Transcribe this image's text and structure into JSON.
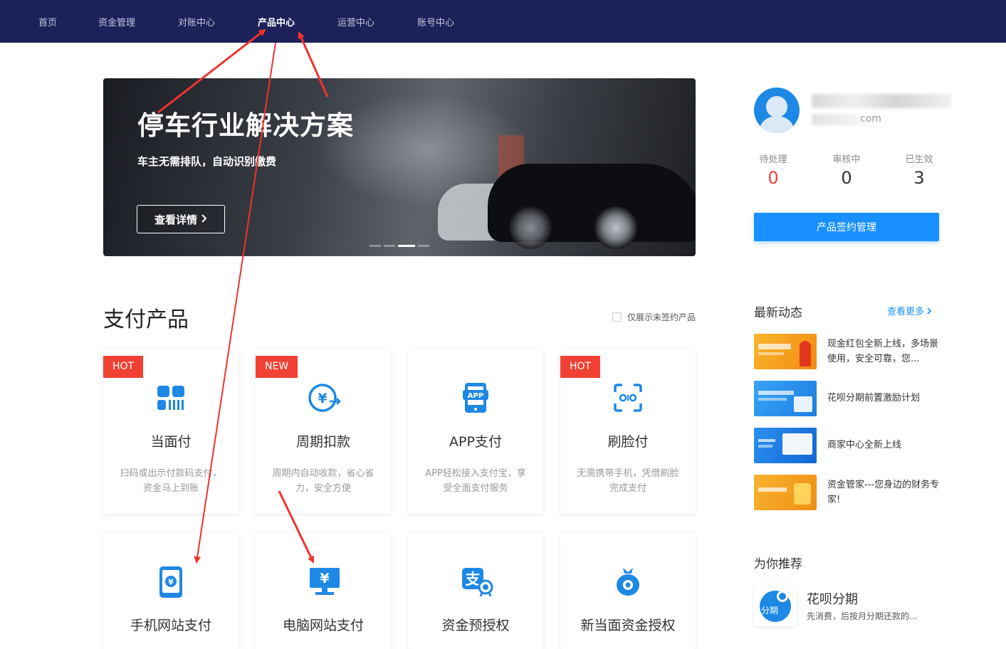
{
  "nav": {
    "items": [
      "首页",
      "资金管理",
      "对账中心",
      "产品中心",
      "运营中心",
      "账号中心"
    ],
    "active_index": 3
  },
  "banner": {
    "title": "停车行业解决方案",
    "subtitle": "车主无需排队，自动识别缴费",
    "button": "查看详情",
    "slide_count": 4,
    "active_slide": 2
  },
  "products": {
    "title": "支付产品",
    "filter_label": "仅展示未签约产品",
    "cards": [
      {
        "badge": "HOT",
        "name": "当面付",
        "desc": "扫码或出示付款码支付，资金马上到账",
        "icon": "qr-pay-icon"
      },
      {
        "badge": "NEW",
        "name": "周期扣款",
        "desc": "周期内自动收款，省心省力，安全方便",
        "icon": "cycle-deduct-icon"
      },
      {
        "badge": "",
        "name": "APP支付",
        "desc": "APP轻松接入支付宝，享受全面支付服务",
        "icon": "app-pay-icon"
      },
      {
        "badge": "HOT",
        "name": "刷脸付",
        "desc": "无需携带手机，凭借刷脸完成支付",
        "icon": "face-pay-icon"
      },
      {
        "badge": "",
        "name": "手机网站支付",
        "desc": "",
        "icon": "mobile-web-pay-icon"
      },
      {
        "badge": "",
        "name": "电脑网站支付",
        "desc": "",
        "icon": "pc-web-pay-icon"
      },
      {
        "badge": "",
        "name": "资金预授权",
        "desc": "",
        "icon": "pre-auth-icon"
      },
      {
        "badge": "",
        "name": "新当面资金授权",
        "desc": "",
        "icon": "new-auth-icon"
      }
    ]
  },
  "profile": {
    "email_suffix": "com",
    "stats": [
      {
        "label": "待处理",
        "value": "0",
        "color": "#f04134"
      },
      {
        "label": "审核中",
        "value": "0",
        "color": "#333333"
      },
      {
        "label": "已生效",
        "value": "3",
        "color": "#333333"
      }
    ],
    "sign_button": "产品签约管理"
  },
  "news": {
    "title": "最新动态",
    "more": "查看更多",
    "items": [
      {
        "text": "现金红包全新上线，多场景使用，安全可靠，您...",
        "thumb_color": "#f7a21b"
      },
      {
        "text": "花呗分期前置激励计划",
        "thumb_color": "#2a8cf0"
      },
      {
        "text": "商家中心全新上线",
        "thumb_color": "#1f7fe6"
      },
      {
        "text": "资金管家---您身边的财务专家!",
        "thumb_color": "#f5a016"
      }
    ]
  },
  "recommend": {
    "title": "为你推荐",
    "name": "花呗分期",
    "desc": "先消费，后按月分期还款的...",
    "icon_label": "分期"
  },
  "colors": {
    "nav_bg": "#1c2159",
    "accent": "#1890ff",
    "hot": "#f04134",
    "annotation_arrow": "#f0332f"
  }
}
